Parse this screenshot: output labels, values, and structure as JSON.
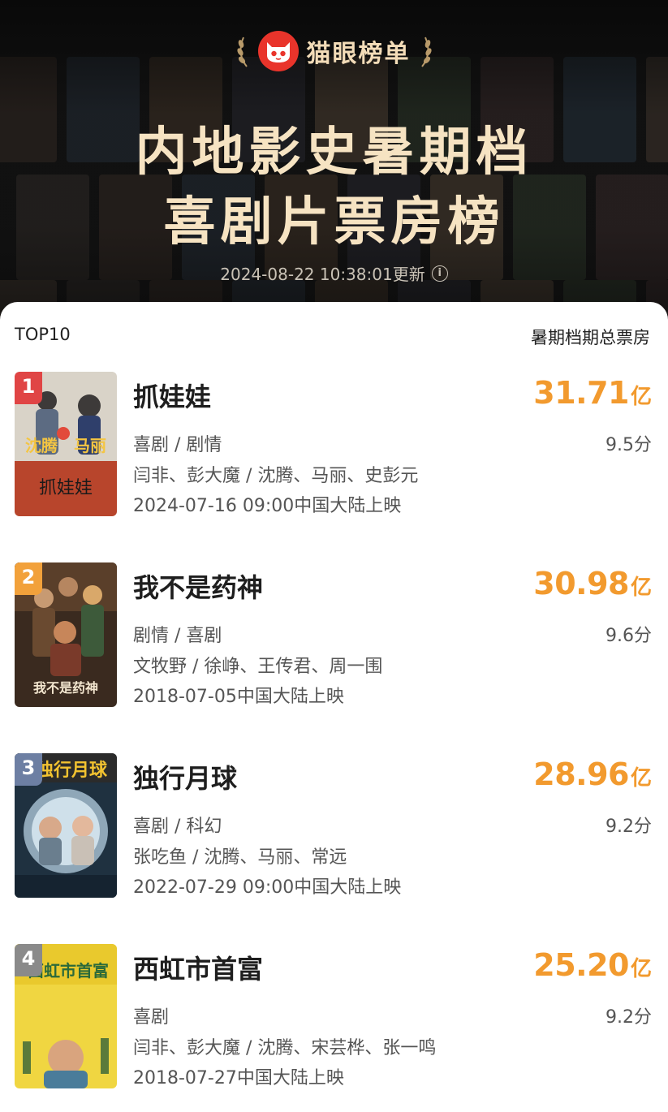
{
  "header": {
    "brand": "猫眼榜单",
    "title_line1": "内地影史暑期档",
    "title_line2": "喜剧片票房榜",
    "updated": "2024-08-22 10:38:01更新",
    "info_icon": "i"
  },
  "list": {
    "left_label": "TOP10",
    "right_label": "暑期档期总票房"
  },
  "colors": {
    "accent_orange": "#f29a2e",
    "rank1": "#e04545",
    "rank2": "#f2a13b",
    "rank3": "#6d7fa3",
    "rank4": "#8a8a8a",
    "title_gold": "#f6e3c2"
  },
  "movies": [
    {
      "rank": "1",
      "title": "抓娃娃",
      "box_office": "31.71",
      "unit": "亿",
      "genres": "喜剧 / 剧情",
      "score": "9.5分",
      "people": "闫非、彭大魔 / 沈腾、马丽、史彭元",
      "release": "2024-07-16 09:00中国大陆上映",
      "poster_text": "沈腾　马丽"
    },
    {
      "rank": "2",
      "title": "我不是药神",
      "box_office": "30.98",
      "unit": "亿",
      "genres": "剧情 / 喜剧",
      "score": "9.6分",
      "people": "文牧野 / 徐峥、王传君、周一围",
      "release": "2018-07-05中国大陆上映",
      "poster_text": "我不是药神"
    },
    {
      "rank": "3",
      "title": "独行月球",
      "box_office": "28.96",
      "unit": "亿",
      "genres": "喜剧 / 科幻",
      "score": "9.2分",
      "people": "张吃鱼 / 沈腾、马丽、常远",
      "release": "2022-07-29 09:00中国大陆上映",
      "poster_text": "独行月球"
    },
    {
      "rank": "4",
      "title": "西虹市首富",
      "box_office": "25.20",
      "unit": "亿",
      "genres": "喜剧",
      "score": "9.2分",
      "people": "闫非、彭大魔 / 沈腾、宋芸桦、张一鸣",
      "release": "2018-07-27中国大陆上映",
      "poster_text": "西虹市首富"
    }
  ]
}
